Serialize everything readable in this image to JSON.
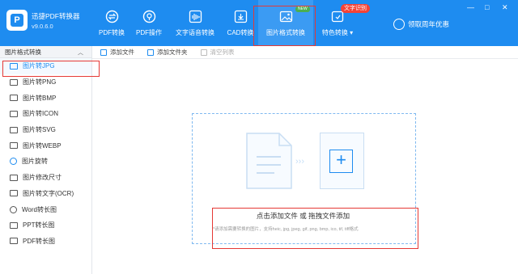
{
  "app": {
    "name": "迅捷PDF转换器",
    "version": "v9.0.6.0"
  },
  "nav": [
    {
      "label": "PDF转换",
      "icon": "exchange-icon"
    },
    {
      "label": "PDF操作",
      "icon": "pdf-ops-icon"
    },
    {
      "label": "文字语音转换",
      "icon": "audio-wave-icon"
    },
    {
      "label": "CAD转换",
      "icon": "cad-icon"
    },
    {
      "label": "图片格式转换",
      "icon": "image-icon"
    },
    {
      "label": "特色转换",
      "icon": "special-icon"
    }
  ],
  "badges": {
    "new": "NEW",
    "ocr": "文字识别"
  },
  "vip": {
    "label": "领取周年优惠"
  },
  "window": {
    "minimize": "—",
    "restore": "□",
    "close": "✕"
  },
  "sidebar": {
    "header": "图片格式转换",
    "items": [
      {
        "label": "图片转JPG"
      },
      {
        "label": "图片转PNG"
      },
      {
        "label": "图片转BMP"
      },
      {
        "label": "图片转ICON"
      },
      {
        "label": "图片转SVG"
      },
      {
        "label": "图片转WEBP"
      },
      {
        "label": "图片旋转"
      },
      {
        "label": "图片修改尺寸"
      },
      {
        "label": "图片转文字(OCR)"
      },
      {
        "label": "Word转长图"
      },
      {
        "label": "PPT转长图"
      },
      {
        "label": "PDF转长图"
      }
    ]
  },
  "toolbar": {
    "add_file": "添加文件",
    "add_folder": "添加文件夹",
    "clear": "清空列表"
  },
  "dropzone": {
    "main_a": "点击添加文件",
    "or": "或",
    "main_b": "拖拽文件添加",
    "hint": "*请添加需要转换的图片，支持heic, jpg, jpeg, gif, png, bmp, ico, tif, tiff格式"
  },
  "colors": {
    "accent": "#1e8cf0",
    "highlight": "#e53935"
  }
}
